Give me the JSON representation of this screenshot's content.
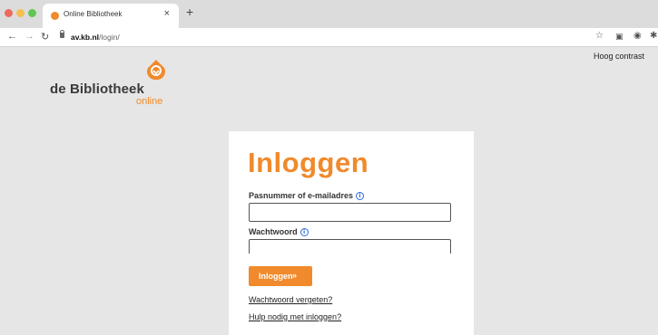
{
  "browser": {
    "tab_title": "Online Bibliotheek",
    "tab_close": "×",
    "new_tab": "+",
    "url_host": "av.kb.nl",
    "url_path": "/login/",
    "icons": {
      "back": "arrow-left-icon",
      "forward": "arrow-right-icon",
      "reload": "reload-icon",
      "lock": "lock-icon",
      "star": "star-icon",
      "camera": "camera-icon",
      "extension": "extension-icon",
      "puzzle": "puzzle-icon"
    }
  },
  "page": {
    "logo": {
      "text": "de Bibliotheek",
      "sub": "online"
    },
    "high_contrast": "Hoog contrast",
    "login": {
      "heading": "Inloggen",
      "username_label": "Pasnummer of e-mailadres",
      "username_value": "",
      "password_label": "Wachtwoord",
      "password_value": "",
      "info_icon": "i",
      "submit_label": "Inloggen",
      "submit_arrow": "»",
      "forgot_link": "Wachtwoord vergeten?",
      "help_link": "Hulp nodig met inloggen?"
    }
  },
  "colors": {
    "accent": "#f08a2c",
    "info": "#2b6ad8",
    "background": "#e6e6e6"
  }
}
